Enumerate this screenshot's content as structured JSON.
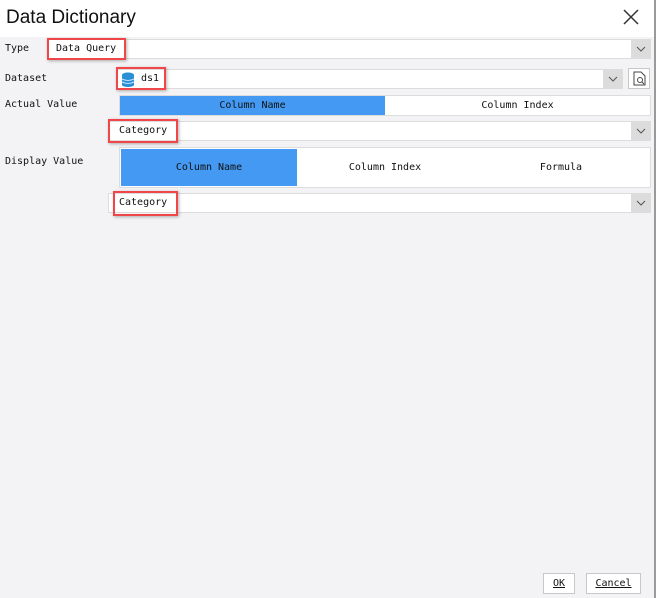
{
  "dialog": {
    "title": "Data Dictionary"
  },
  "type": {
    "label": "Type",
    "value": "Data Query"
  },
  "dataset": {
    "label": "Dataset",
    "value": "ds1"
  },
  "actual_value": {
    "label": "Actual Value",
    "tabs": [
      "Column Name",
      "Column Index"
    ],
    "selected": "Column Name",
    "value": "Category"
  },
  "display_value": {
    "label": "Display Value",
    "tabs": [
      "Column Name",
      "Column Index",
      "Formula"
    ],
    "selected": "Column Name",
    "value": "Category"
  },
  "buttons": {
    "ok": "OK",
    "cancel": "Cancel"
  },
  "colors": {
    "accent": "#4499f2",
    "highlight": "#f0464a"
  }
}
